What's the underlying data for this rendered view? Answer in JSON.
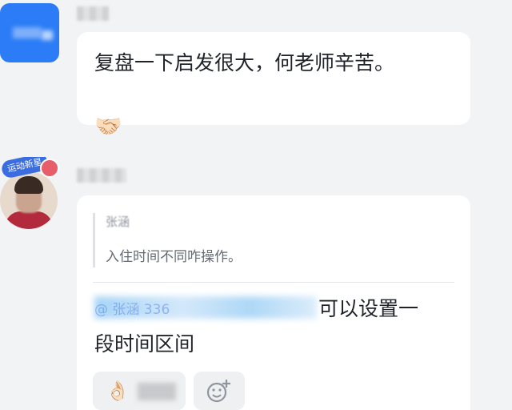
{
  "messages": [
    {
      "text": "复盘一下启发很大，何老师辛苦。",
      "emoji": "🤝🏻"
    },
    {
      "avatar_badge": "运动新星",
      "quote": {
        "author": "张涵",
        "text": "入住时间不同咋操作。"
      },
      "mention": "@ 张涵 336",
      "reply_line1": "可以设置一",
      "reply_line2": "段时间区间",
      "reactions": [
        {
          "emoji": "👌🏻"
        }
      ]
    }
  ],
  "colors": {
    "background": "#f2f3f5",
    "bubble": "#ffffff",
    "accent": "#2b7cf6"
  },
  "icons": [
    "handshake-emoji",
    "ok-hand-emoji",
    "add-reaction-icon"
  ]
}
